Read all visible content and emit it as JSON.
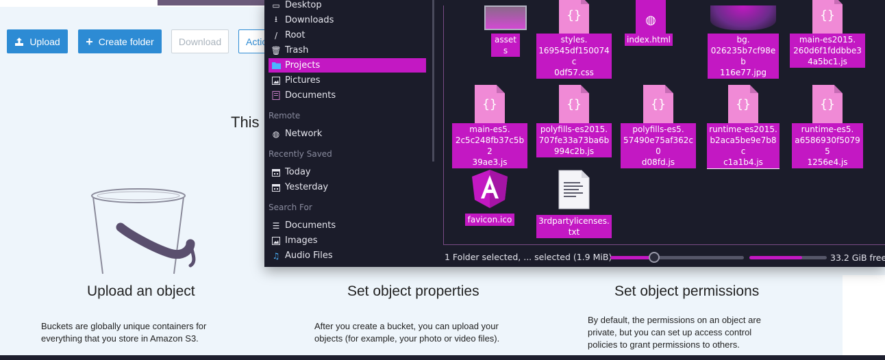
{
  "s3_page": {
    "toolbar": {
      "upload_label": "Upload",
      "create_folder_label": "Create folder",
      "download_label": "Download",
      "actions_label": "Actio"
    },
    "heading": "This",
    "cards": [
      {
        "title": "Upload an object",
        "description": "Buckets are globally unique containers for everything that you store in Amazon S3."
      },
      {
        "title": "Set object properties",
        "description": "After you create a bucket, you can upload your objects (for example, your photo or video files)."
      },
      {
        "title": "Set object permissions",
        "description": "By default, the permissions on an object are private, but you can set up access control policies to grant permissions to others."
      }
    ]
  },
  "file_dialog": {
    "places": {
      "items": [
        {
          "label": "Desktop",
          "icon": "desktop-icon"
        },
        {
          "label": "Downloads",
          "icon": "downloads-icon"
        },
        {
          "label": "Root",
          "icon": "root-icon"
        },
        {
          "label": "Trash",
          "icon": "trash-icon"
        },
        {
          "label": "Projects",
          "icon": "folder-icon"
        },
        {
          "label": "Pictures",
          "icon": "pictures-icon"
        },
        {
          "label": "Documents",
          "icon": "documents-icon"
        }
      ],
      "remote_label": "Remote",
      "remote_items": [
        {
          "label": "Network",
          "icon": "network-icon"
        }
      ],
      "recently_saved_label": "Recently Saved",
      "recent_items": [
        {
          "label": "Today",
          "icon": "calendar-icon"
        },
        {
          "label": "Yesterday",
          "icon": "calendar-icon"
        }
      ],
      "search_for_label": "Search For",
      "search_items": [
        {
          "label": "Documents",
          "icon": "document-lines-icon"
        },
        {
          "label": "Images",
          "icon": "image-icon"
        },
        {
          "label": "Audio Files",
          "icon": "music-note-icon"
        }
      ]
    },
    "files": [
      {
        "name": "assets",
        "kind": "folder"
      },
      {
        "name": "styles.\n169545df150074c\n0df57.css",
        "kind": "css"
      },
      {
        "name": "index.html",
        "kind": "html"
      },
      {
        "name": "bg.\n026235b7cf98eb\n116e77.jpg",
        "kind": "jpg"
      },
      {
        "name": "main-es2015.\n260d6f1fddbbe3\n4a5bc1.js",
        "kind": "js"
      },
      {
        "name": "main-es5.\n2c5c248fb37c5b2\n39ae3.js",
        "kind": "js"
      },
      {
        "name": "polyfills-es2015.\n707fe33a73ba6b\n994c2b.js",
        "kind": "js"
      },
      {
        "name": "polyfills-es5.\n57490e75af362c0\nd08fd.js",
        "kind": "js"
      },
      {
        "name": "runtime-es2015.\nb2aca5be9e7b8c\nc1a1b4.js",
        "kind": "js"
      },
      {
        "name": "runtime-es5.\na6586930f50795\n1256e4.js",
        "kind": "js"
      },
      {
        "name": "favicon.ico",
        "kind": "angular"
      },
      {
        "name": "3rdpartylicenses.\ntxt",
        "kind": "txt"
      }
    ],
    "status_text": "1 Folder selected, ... selected (1.9 MiB)",
    "zoom_level": 0.33,
    "free_space_used_fraction": 0.68,
    "free_space_text": "33.2 GiB free"
  },
  "colors": {
    "accent": "#c318c3",
    "s3_blue": "#2d8bd4",
    "dialog_bg": "#1b1c2a"
  }
}
